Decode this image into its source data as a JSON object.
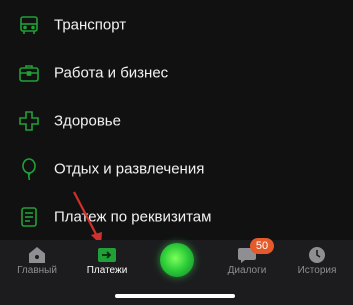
{
  "menu": {
    "items": [
      {
        "label": "Транспорт",
        "icon": "bus-icon"
      },
      {
        "label": "Работа и бизнес",
        "icon": "briefcase-icon"
      },
      {
        "label": "Здоровье",
        "icon": "health-cross-icon"
      },
      {
        "label": "Отдых и развлечения",
        "icon": "balloon-icon"
      },
      {
        "label": "Платеж по реквизитам",
        "icon": "document-icon"
      }
    ]
  },
  "tabbar": {
    "home_label": "Главный",
    "payments_label": "Платежи",
    "assistant_icon": "assistant-orb-icon",
    "dialogs_label": "Диалоги",
    "dialogs_badge": "50",
    "history_label": "История"
  },
  "colors": {
    "accent_green": "#21a038",
    "badge_orange": "#e65a2a",
    "arrow_red": "#d0312d"
  }
}
